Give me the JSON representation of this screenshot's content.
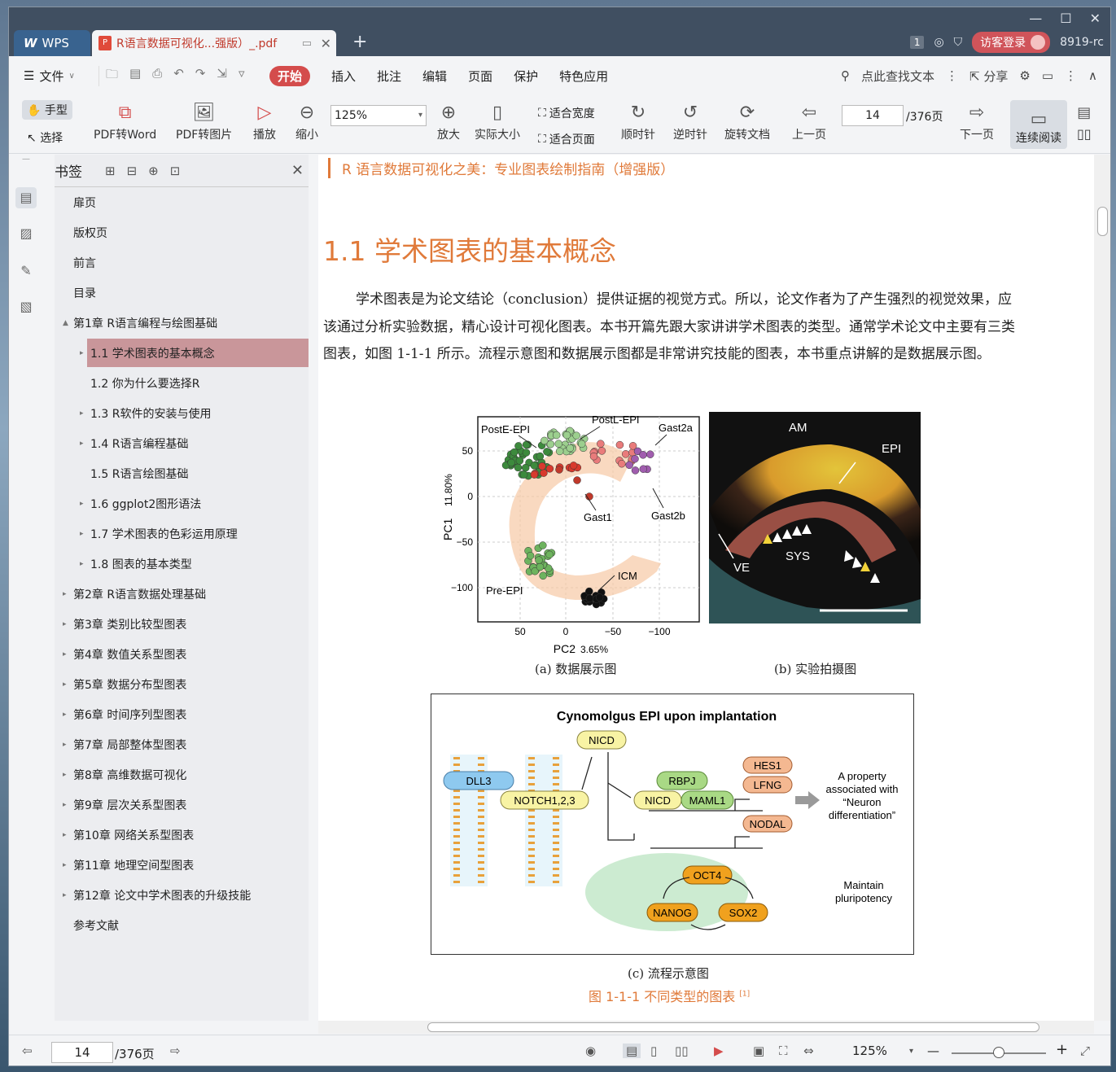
{
  "window": {
    "controls": [
      "—",
      "☐",
      "✕"
    ],
    "tabs": {
      "wps_label": "WPS",
      "doc_label": "R语言数据可视化...强版）_.pdf",
      "new_tab": "+"
    },
    "page_badge": "1",
    "login_label": "访客登录",
    "user_id": "8919-rc"
  },
  "menu": {
    "file": "文件",
    "tabs": [
      "开始",
      "插入",
      "批注",
      "编辑",
      "页面",
      "保护",
      "特色应用"
    ],
    "active_tab": "开始",
    "search_label": "点此查找文本",
    "share_label": "分享"
  },
  "toolbar": {
    "hand": "手型",
    "select": "选择",
    "pdf_to_word": "PDF转Word",
    "pdf_to_image": "PDF转图片",
    "play": "播放",
    "zoom_out": "缩小",
    "zoom_value": "125%",
    "zoom_in": "放大",
    "actual_size": "实际大小",
    "fit_width": "适合宽度",
    "fit_page": "适合页面",
    "rotate_cw": "顺时针",
    "rotate_ccw": "逆时针",
    "rotate_doc": "旋转文档",
    "prev_page": "上一页",
    "page_value": "14",
    "page_total": "/376页",
    "next_page": "下一页",
    "continuous": "连续阅读"
  },
  "bookmarks": {
    "title": "书签",
    "items": [
      {
        "label": "扉页",
        "level": 0,
        "arrow": ""
      },
      {
        "label": "版权页",
        "level": 0,
        "arrow": ""
      },
      {
        "label": "前言",
        "level": 0,
        "arrow": ""
      },
      {
        "label": "目录",
        "level": 0,
        "arrow": ""
      },
      {
        "label": "第1章  R语言编程与绘图基础",
        "level": 0,
        "arrow": "▲"
      },
      {
        "label": "1.1  学术图表的基本概念",
        "level": 1,
        "arrow": "▸"
      },
      {
        "label": "1.2  你为什么要选择R",
        "level": 1,
        "arrow": ""
      },
      {
        "label": "1.3  R软件的安装与使用",
        "level": 1,
        "arrow": "▸"
      },
      {
        "label": "1.4  R语言编程基础",
        "level": 1,
        "arrow": "▸"
      },
      {
        "label": "1.5  R语言绘图基础",
        "level": 1,
        "arrow": ""
      },
      {
        "label": "1.6  ggplot2图形语法",
        "level": 1,
        "arrow": "▸"
      },
      {
        "label": "1.7  学术图表的色彩运用原理",
        "level": 1,
        "arrow": "▸"
      },
      {
        "label": "1.8  图表的基本类型",
        "level": 1,
        "arrow": "▸"
      },
      {
        "label": "第2章  R语言数据处理基础",
        "level": 0,
        "arrow": "▸"
      },
      {
        "label": "第3章  类别比较型图表",
        "level": 0,
        "arrow": "▸"
      },
      {
        "label": "第4章  数值关系型图表",
        "level": 0,
        "arrow": "▸"
      },
      {
        "label": "第5章  数据分布型图表",
        "level": 0,
        "arrow": "▸"
      },
      {
        "label": "第6章  时间序列型图表",
        "level": 0,
        "arrow": "▸"
      },
      {
        "label": "第7章  局部整体型图表",
        "level": 0,
        "arrow": "▸"
      },
      {
        "label": "第8章  高维数据可视化",
        "level": 0,
        "arrow": "▸"
      },
      {
        "label": "第9章  层次关系型图表",
        "level": 0,
        "arrow": "▸"
      },
      {
        "label": "第10章  网络关系型图表",
        "level": 0,
        "arrow": "▸"
      },
      {
        "label": "第11章  地理空间型图表",
        "level": 0,
        "arrow": "▸"
      },
      {
        "label": "第12章  论文中学术图表的升级技能",
        "level": 0,
        "arrow": "▸"
      },
      {
        "label": "参考文献",
        "level": 0,
        "arrow": ""
      }
    ],
    "selected_index": 5
  },
  "doc": {
    "running_head": "R 语言数据可视化之美：专业图表绘制指南（增强版）",
    "heading": "1.1   学术图表的基本概念",
    "paragraph": "学术图表是为论文结论（conclusion）提供证据的视觉方式。所以，论文作者为了产生强烈的视觉效果，应该通过分析实验数据，精心设计可视化图表。本书开篇先跟大家讲讲学术图表的类型。通常学术论文中主要有三类图表，如图 1-1-1 所示。流程示意图和数据展示图都是非常讲究技能的图表，本书重点讲解的是数据展示图。",
    "caption_a": "(a)  数据展示图",
    "caption_b": "(b)  实验拍摄图",
    "caption_c": "(c)  流程示意图",
    "figure_caption": "图 1-1-1    不同类型的图表",
    "figure_ref": "[1]",
    "pca": {
      "xlabel": "PC2",
      "xlabel_pct": "3.65%",
      "ylabel": "PC1",
      "ylabel_pct": "11.80%",
      "xticks": [
        "50",
        "0",
        "−50",
        "−100"
      ],
      "yticks": [
        "50",
        "0",
        "−50",
        "−100"
      ],
      "labels": [
        "PostE-EPI",
        "PostL-EPI",
        "Gast2a",
        "Gast1",
        "Gast2b",
        "Pre-EPI",
        "ICM"
      ]
    },
    "photo_labels": [
      "AM",
      "EPI",
      "VE",
      "SYS"
    ],
    "diagram": {
      "title": "Cynomolgus EPI upon implantation",
      "nodes": [
        "NICD",
        "DLL3",
        "NOTCH1,2,3",
        "RBPJ",
        "NICD",
        "MAML1",
        "HES1",
        "LFNG",
        "NODAL",
        "OCT4",
        "NANOG",
        "SOX2"
      ],
      "note1": [
        "A property",
        "associated with",
        "“Neuron",
        "differentiation”"
      ],
      "note2": [
        "Maintain",
        "pluripotency"
      ]
    }
  },
  "statusbar": {
    "page_value": "14",
    "page_total": "/376页",
    "zoom": "125%",
    "zoom_level": 0.5
  }
}
